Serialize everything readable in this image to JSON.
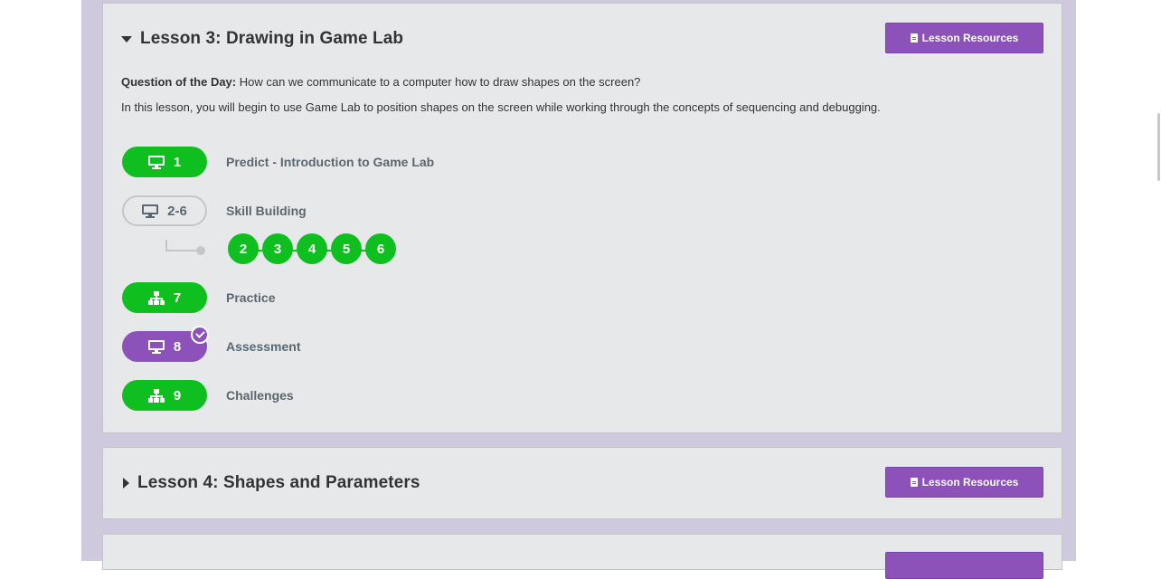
{
  "lessons": [
    {
      "title": "Lesson 3: Drawing in Game Lab",
      "expanded": true,
      "resources_label": "Lesson Resources",
      "qotd_label": "Question of the Day:",
      "qotd_text": " How can we communicate to a computer how to draw shapes on the screen?",
      "description": "In this lesson, you will begin to use Game Lab to position shapes on the screen while working through the concepts of sequencing and debugging.",
      "activities": [
        {
          "number": "1",
          "label": "Predict - Introduction to Game Lab",
          "icon": "desktop-icon",
          "status": "completed"
        },
        {
          "number": "2-6",
          "label": "Skill Building",
          "icon": "desktop-icon",
          "status": "not-started",
          "sublevels": [
            "2",
            "3",
            "4",
            "5",
            "6"
          ]
        },
        {
          "number": "7",
          "label": "Practice",
          "icon": "sitemap-icon",
          "status": "completed"
        },
        {
          "number": "8",
          "label": "Assessment",
          "icon": "desktop-icon",
          "status": "submitted"
        },
        {
          "number": "9",
          "label": "Challenges",
          "icon": "sitemap-icon",
          "status": "completed"
        }
      ]
    },
    {
      "title": "Lesson 4: Shapes and Parameters",
      "expanded": false,
      "resources_label": "Lesson Resources"
    }
  ],
  "colors": {
    "completed": "#0fbf1f",
    "submitted": "#8c52ba",
    "resources_button": "#8c52ba",
    "background_band": "#cfc9de",
    "card": "#e7e8ea"
  }
}
